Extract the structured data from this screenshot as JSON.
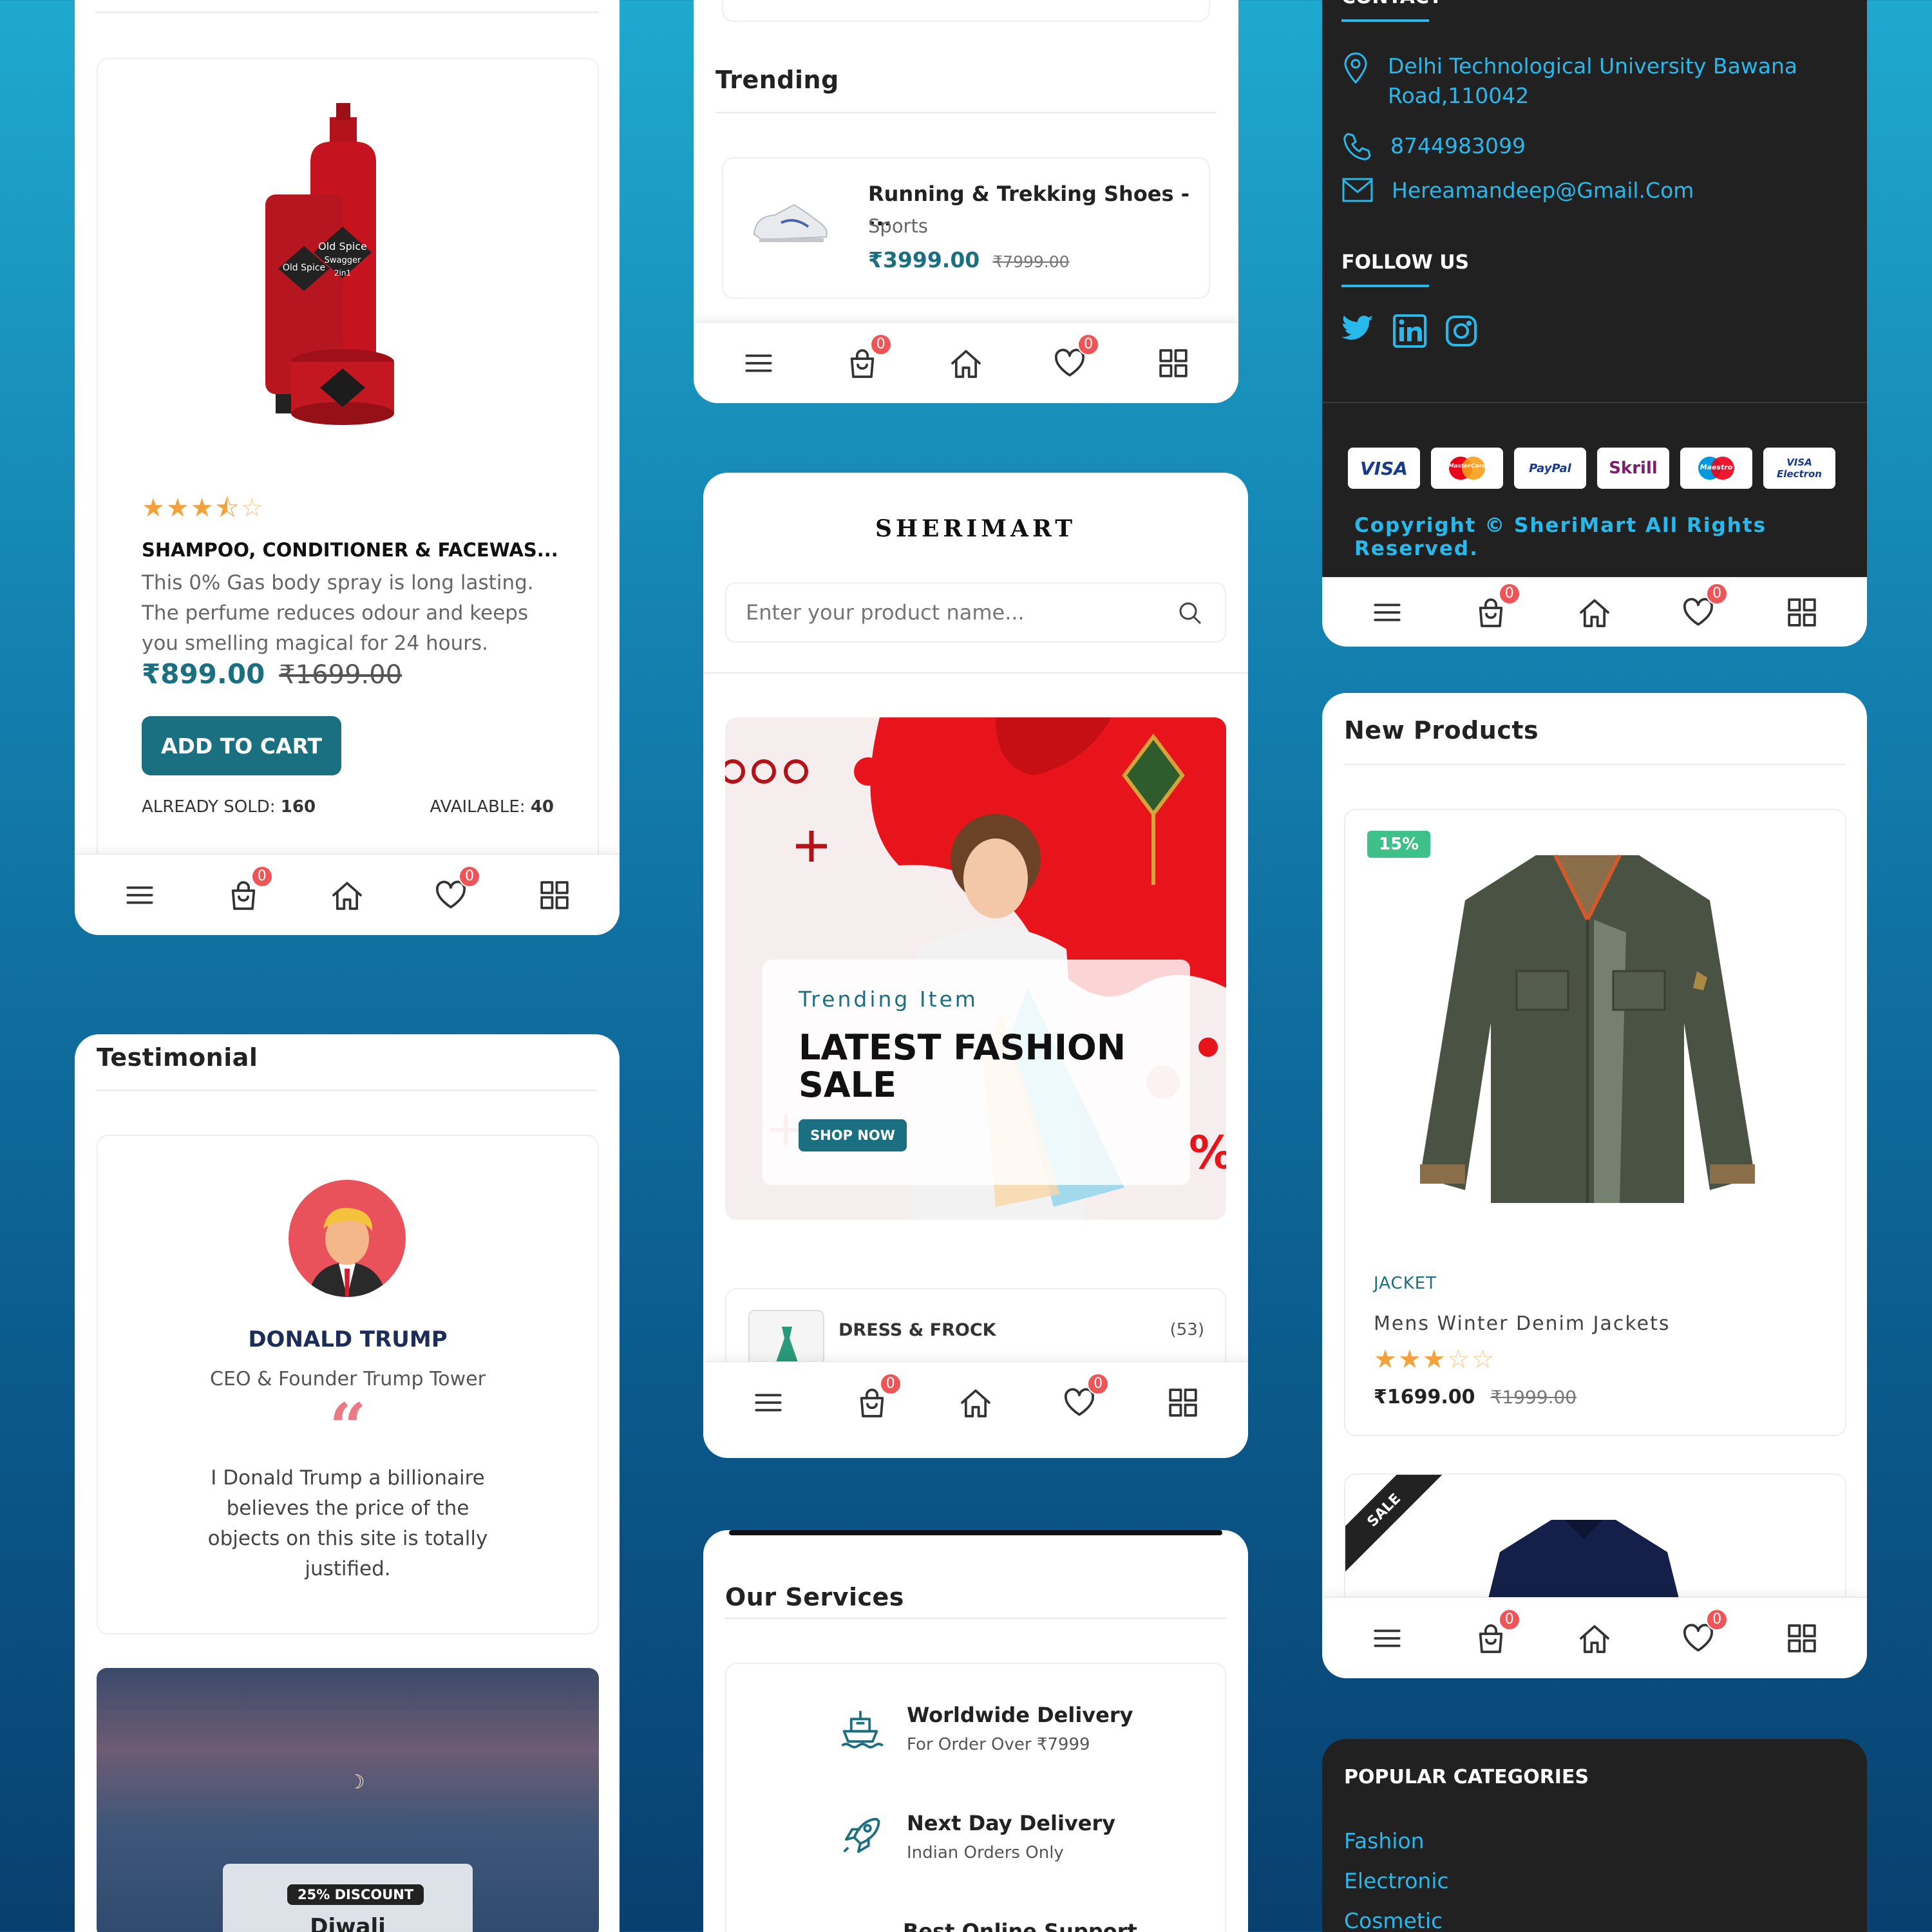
{
  "nav": {
    "badge_cart": "0",
    "badge_wish": "0"
  },
  "product": {
    "rating_stars": 3.5,
    "title": "SHAMPOO, CONDITIONER & FACEWAS...",
    "description_lines": [
      "This 0% Gas body spray is long lasting.",
      "The perfume reduces odour and keeps",
      "you smelling magical for 24 hours."
    ],
    "price": "₹899.00",
    "old_price": "₹1699.00",
    "cart_button": "ADD TO CART",
    "sold_label": "ALREADY SOLD:",
    "sold_value": "160",
    "avail_label": "AVAILABLE:",
    "avail_value": "40",
    "image_text_1": "Old Spice",
    "image_text_2": "Swagger",
    "image_text_3": "2in1"
  },
  "trending": {
    "title": "Trending",
    "item_name": "Running & Trekking Shoes - ...",
    "item_cat": "Sports",
    "item_price": "₹3999.00",
    "item_old": "₹7999.00"
  },
  "contact": {
    "heading": "CONTACT",
    "address_1": "Delhi Technological University Bawana",
    "address_2": "Road,110042",
    "phone": "8744983099",
    "email": "Hereamandeep@Gmail.Com",
    "follow": "FOLLOW US",
    "payments": [
      "VISA",
      "MasterCard",
      "PayPal",
      "Skrill",
      "Maestro",
      "VISA Electron"
    ],
    "copyright": "Copyright © SheriMart All Rights Reserved."
  },
  "home": {
    "logo": "SHERIMART",
    "search_placeholder": "Enter your product name...",
    "banner_kicker": "Trending Item",
    "banner_title_1": "LATEST FASHION",
    "banner_title_2": "SALE",
    "banner_button": "SHOP NOW",
    "category_name": "DRESS & FROCK",
    "category_count": "(53)"
  },
  "testimonial": {
    "title": "Testimonial",
    "name": "DONALD TRUMP",
    "role": "CEO & Founder Trump Tower",
    "quote_lines": [
      "I Donald Trump a billionaire",
      "believes the price of the",
      "objects on this site is totally",
      "justified."
    ],
    "discount_badge": "25% DISCOUNT",
    "discount_title": "Diwali"
  },
  "new_products": {
    "title": "New Products",
    "badge": "15%",
    "category": "JACKET",
    "name": "Mens Winter Denim Jackets",
    "rating_stars": 3,
    "price": "₹1699.00",
    "old_price": "₹1999.00",
    "sale_ribbon": "SALE"
  },
  "services": {
    "title": "Our Services",
    "items": [
      {
        "title": "Worldwide Delivery",
        "sub": "For Order Over ₹7999"
      },
      {
        "title": "Next Day Delivery",
        "sub": "Indian Orders Only"
      },
      {
        "title": "Best Online Support",
        "sub": ""
      }
    ]
  },
  "popular": {
    "title": "POPULAR CATEGORIES",
    "links": [
      "Fashion",
      "Electronic",
      "Cosmetic"
    ]
  }
}
